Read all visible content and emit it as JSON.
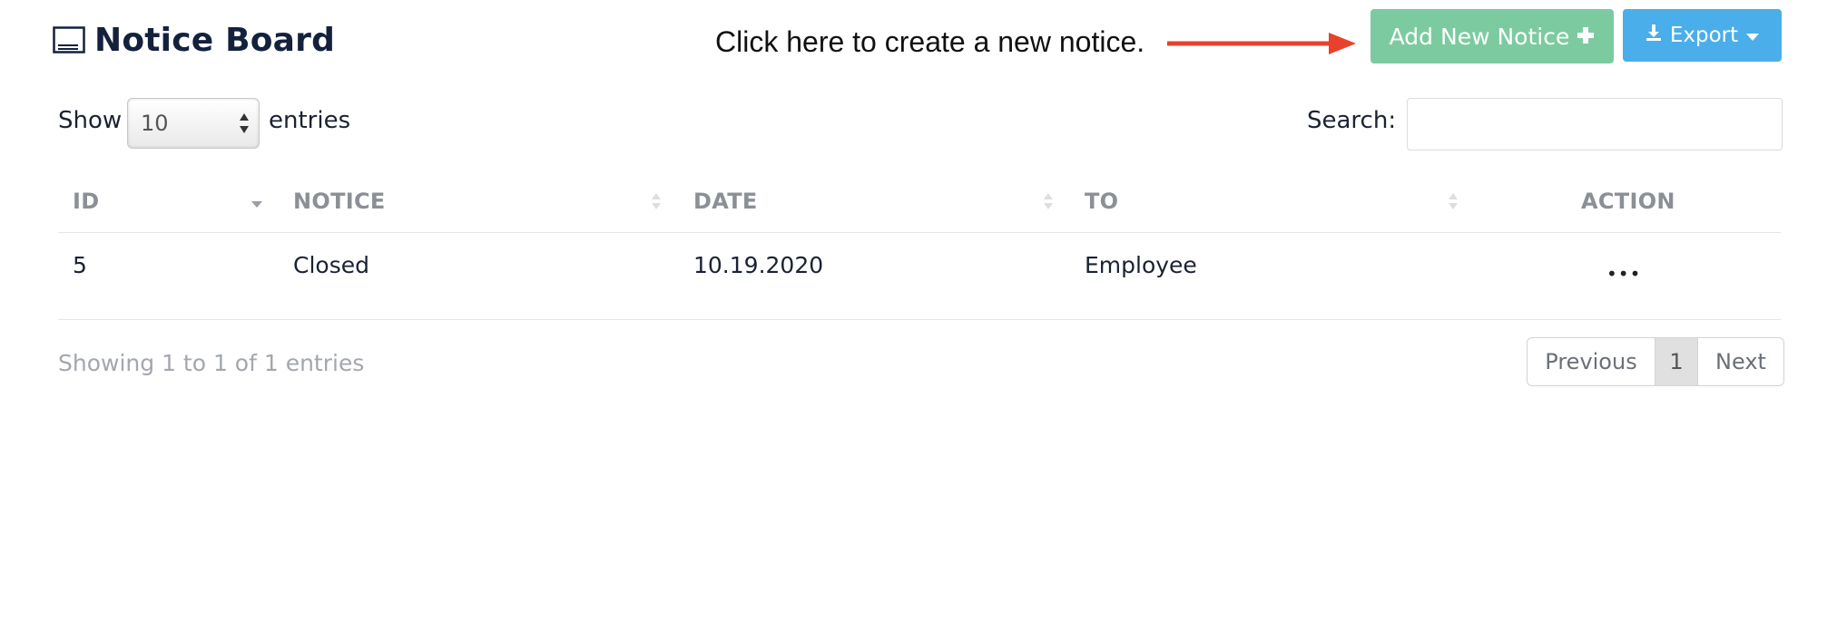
{
  "header": {
    "title": "Notice Board",
    "hint": "Click here to create a new notice.",
    "add_button_label": "Add New Notice",
    "export_button_label": "Export"
  },
  "controls": {
    "show_label": "Show",
    "page_size": "10",
    "entries_label": "entries",
    "search_label": "Search:",
    "search_value": ""
  },
  "table": {
    "columns": [
      "ID",
      "NOTICE",
      "DATE",
      "TO",
      "ACTION"
    ],
    "rows": [
      {
        "id": "5",
        "notice": "Closed",
        "date": "10.19.2020",
        "to": "Employee",
        "action": "•••"
      }
    ]
  },
  "footer": {
    "info": "Showing 1 to 1 of 1 entries",
    "previous_label": "Previous",
    "current_page": "1",
    "next_label": "Next"
  },
  "colors": {
    "add_button": "#7ccba0",
    "export_button": "#4aaeea",
    "annotation_arrow": "#e8412c",
    "title": "#14213d"
  },
  "icons": {
    "title": "notice-board-icon",
    "add": "plus-icon",
    "export": "download-icon",
    "export_caret": "caret-down-icon"
  }
}
